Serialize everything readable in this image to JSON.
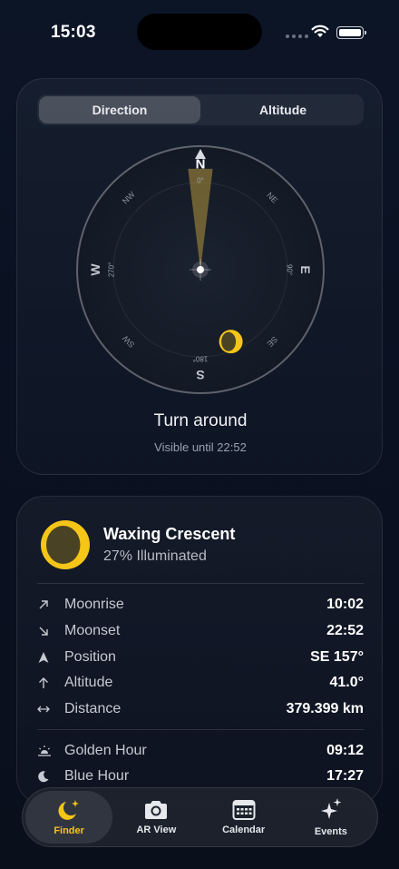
{
  "status_bar": {
    "time": "15:03"
  },
  "segmented": {
    "options": [
      "Direction",
      "Altitude"
    ],
    "selected": "Direction"
  },
  "compass": {
    "cardinals": {
      "n": "N",
      "e": "E",
      "s": "S",
      "w": "W"
    },
    "intercardinals": {
      "ne": "NE",
      "se": "SE",
      "sw": "SW",
      "nw": "NW"
    },
    "degrees": {
      "n": "0°",
      "e": "90°",
      "s": "180°",
      "w": "270°"
    },
    "heading_deg": 0,
    "moon_azimuth_deg": 157,
    "accent": "#f5c518"
  },
  "guidance": {
    "title": "Turn around",
    "subtitle": "Visible until 22:52"
  },
  "moon": {
    "phase_name": "Waxing Crescent",
    "illumination_text": "27% Illuminated",
    "illumination": 0.27
  },
  "details": [
    {
      "icon": "arrow-up-right-icon",
      "label": "Moonrise",
      "value": "10:02"
    },
    {
      "icon": "arrow-down-right-icon",
      "label": "Moonset",
      "value": "22:52"
    },
    {
      "icon": "location-arrow-icon",
      "label": "Position",
      "value": "SE 157°"
    },
    {
      "icon": "arrow-up-icon",
      "label": "Altitude",
      "value": "41.0°"
    },
    {
      "icon": "arrows-horizontal-icon",
      "label": "Distance",
      "value": "379.399 km"
    }
  ],
  "hours": [
    {
      "icon": "sunrise-icon",
      "label": "Golden Hour",
      "value": "09:12"
    },
    {
      "icon": "moon-icon",
      "label": "Blue Hour",
      "value": "17:27"
    }
  ],
  "tabs": [
    {
      "icon": "moon-stars-icon",
      "label": "Finder",
      "active": true
    },
    {
      "icon": "camera-icon",
      "label": "AR View",
      "active": false
    },
    {
      "icon": "calendar-icon",
      "label": "Calendar",
      "active": false
    },
    {
      "icon": "sparkles-icon",
      "label": "Events",
      "active": false
    }
  ]
}
